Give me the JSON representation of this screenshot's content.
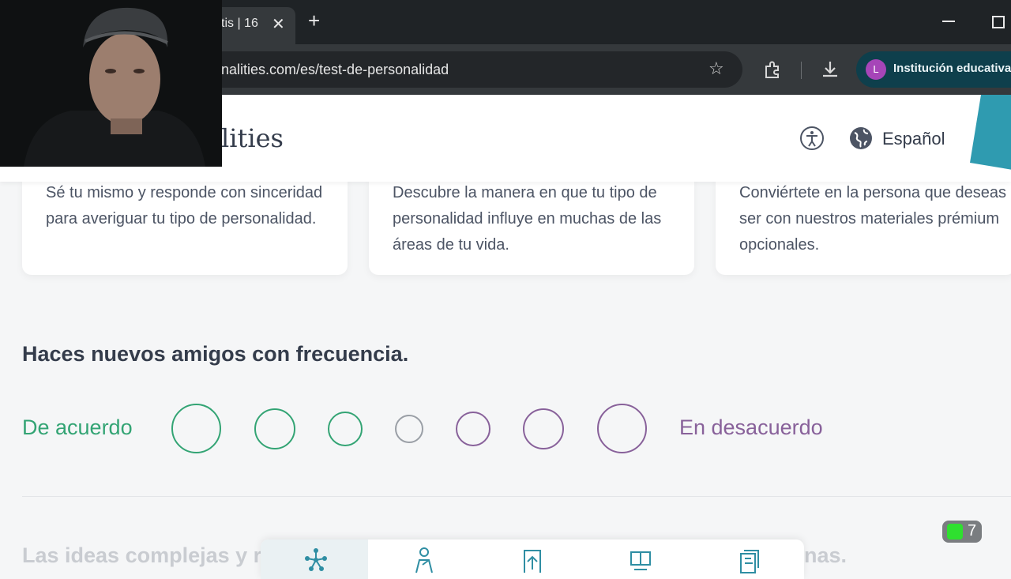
{
  "browser": {
    "tab_title": "tis | 16",
    "url": "nalities.com/es/test-de-personalidad",
    "profile_initial": "L",
    "profile_name": "Institución educativa",
    "accent_profile": "#a645b8"
  },
  "header": {
    "logo_text": "lities",
    "language": "Español",
    "accent_teal": "#2f9bb0"
  },
  "cards": [
    {
      "text": "Sé tu mismo y responde con sinceridad para averiguar tu tipo de personalidad."
    },
    {
      "text": "Descubre la manera en que tu tipo de personalidad influye en muchas de las áreas de tu vida."
    },
    {
      "text": "Conviértete en la persona que deseas ser con nuestros materiales prémium opcionales."
    }
  ],
  "question": {
    "text": "Haces nuevos amigos con frecuencia.",
    "agree_label": "De acuerdo",
    "disagree_label": "En desacuerdo",
    "agree_color": "#33a474",
    "neutral_color": "#9a9fa6",
    "disagree_color": "#88619a",
    "selected": null
  },
  "next_question": {
    "text_start": "Las ideas complejas y r",
    "text_end": "nas."
  },
  "bottom_nav": {
    "items": [
      "network-icon",
      "person-flag-icon",
      "upload-doc-icon",
      "people-shield-icon",
      "documents-icon"
    ],
    "active_index": 0
  },
  "badge": {
    "count": "7"
  }
}
